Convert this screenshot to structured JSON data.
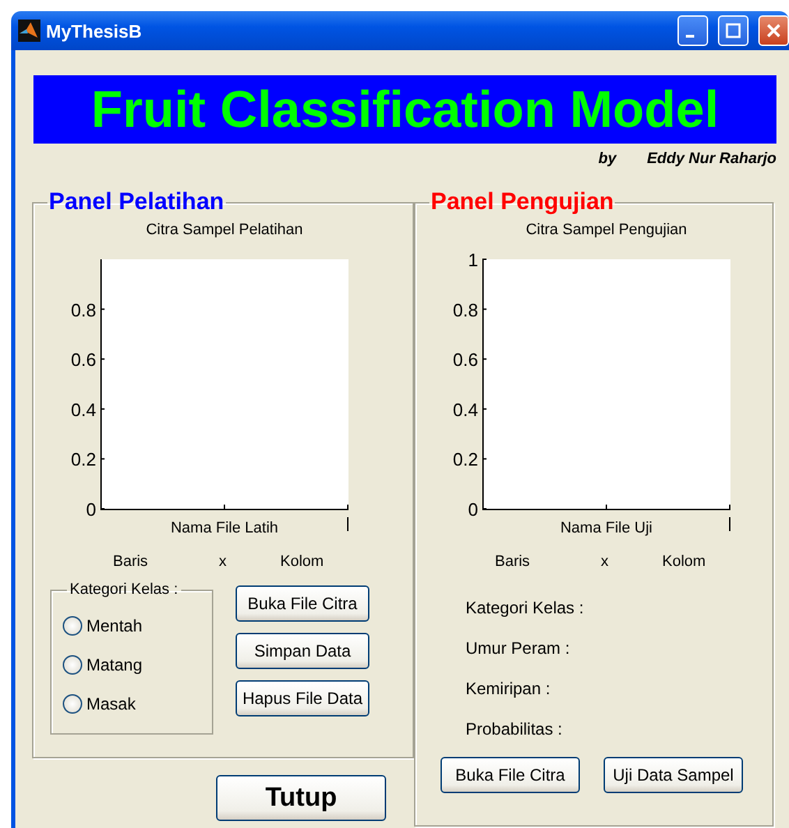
{
  "window": {
    "title": "MyThesisB"
  },
  "banner": {
    "title": "Fruit Classification Model",
    "byline_prefix": "by",
    "author": "Eddy Nur Raharjo"
  },
  "training_panel": {
    "title": "Panel Pelatihan",
    "plot": {
      "title": "Citra Sampel Pelatihan",
      "y_tick_labels": [
        "0.8",
        "0.6",
        "0.4",
        "0.2",
        "0"
      ],
      "xlabel": "Nama File Latih"
    },
    "size_row": [
      "Baris",
      "x",
      "Kolom"
    ],
    "class_group": {
      "title": "Kategori Kelas :",
      "options": [
        {
          "label": "Mentah",
          "selected": false
        },
        {
          "label": "Matang",
          "selected": false
        },
        {
          "label": "Masak",
          "selected": false
        }
      ]
    },
    "buttons": [
      "Buka File Citra",
      "Simpan Data",
      "Hapus File Data"
    ]
  },
  "close_button": "Tutup",
  "testing_panel": {
    "title": "Panel Pengujian",
    "plot": {
      "title": "Citra Sampel Pengujian",
      "y_tick_labels": [
        "1",
        "0.8",
        "0.6",
        "0.4",
        "0.2",
        "0"
      ],
      "xlabel": "Nama File Uji"
    },
    "size_row": [
      "Baris",
      "x",
      "Kolom"
    ],
    "results": [
      "Kategori Kelas :",
      "Umur Peram :",
      "Kemiripan :",
      "Probabilitas :"
    ],
    "buttons": [
      "Buka File Citra",
      "Uji Data Sampel"
    ]
  }
}
